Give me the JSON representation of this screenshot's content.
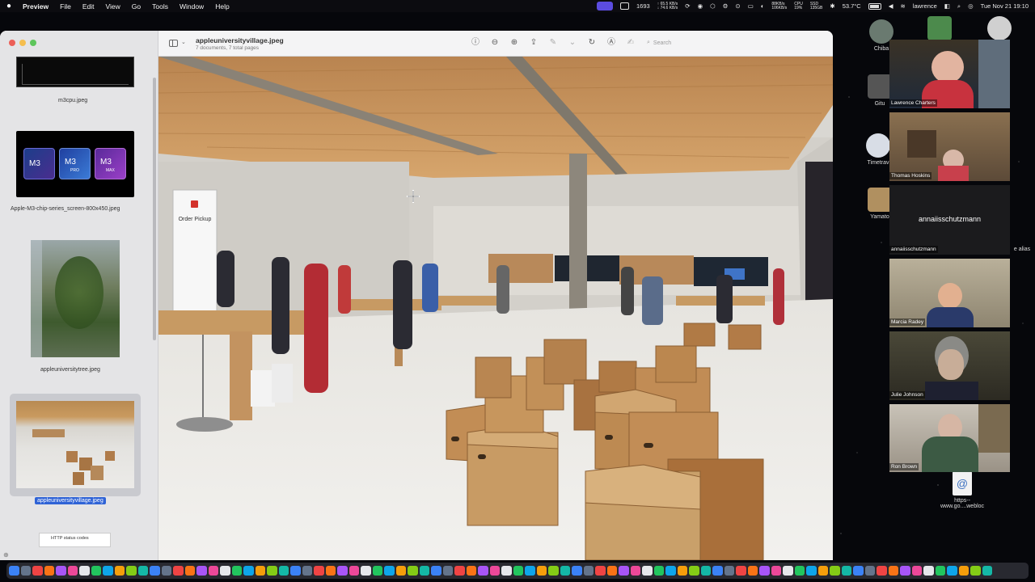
{
  "menubar": {
    "app_name": "Preview",
    "menus": [
      "File",
      "Edit",
      "View",
      "Go",
      "Tools",
      "Window",
      "Help"
    ],
    "status": {
      "counter": "1693",
      "net_up": "↑ 65.5 KB/s",
      "net_down": "↓ 74.6 KB/s",
      "disk_read": "88KB/s",
      "disk_write": "106KB/s",
      "cpu_label": "CPU",
      "cpu_value": "19%",
      "ssd_label": "SSD",
      "ssd_value": "135GB",
      "temperature": "53.7°C",
      "user": "lawrence",
      "datetime": "Tue Nov 21  19:10"
    }
  },
  "window": {
    "title": "appleuniversityvillage.jpeg",
    "subtitle": "7 documents, 7 total pages",
    "search_placeholder": "Search",
    "thumbnails": [
      {
        "label": "m3cpu.jpeg"
      },
      {
        "label": "Apple-M3-chip-series_screen-800x450.jpeg",
        "chips": [
          "M3",
          "M3",
          "M3"
        ],
        "chip_tiers": [
          "",
          "PRO",
          "MAX"
        ]
      },
      {
        "label": "appleuniversitytree.jpeg"
      },
      {
        "label": "appleuniversityvillage.jpeg",
        "selected": true
      },
      {
        "label": "HTTP status codes"
      }
    ],
    "photo": {
      "sign_text": "Order Pickup"
    }
  },
  "zoom": {
    "participants": [
      {
        "name": "Lawrence Charters"
      },
      {
        "name": "Thomas Hoskins"
      },
      {
        "name": "annaiisschutzmann",
        "center_label": "annaiisschutzmann"
      },
      {
        "name": "Marcia Radey"
      },
      {
        "name": "Julie Johnson"
      },
      {
        "name": "Ron Brown"
      }
    ],
    "desktop_icons": [
      {
        "label": "Chiba"
      },
      {
        "label": "Gitu"
      },
      {
        "label": "Timetrav"
      },
      {
        "label": "Yamato"
      },
      {
        "label": "e alias"
      },
      {
        "label": "https--www.go....webloc",
        "line1": "https--",
        "line2": "www.go....webloc"
      }
    ]
  },
  "colors": {
    "selection": "#2f63d6",
    "menubar": "#0c0c10",
    "wood": "#c79a63"
  }
}
